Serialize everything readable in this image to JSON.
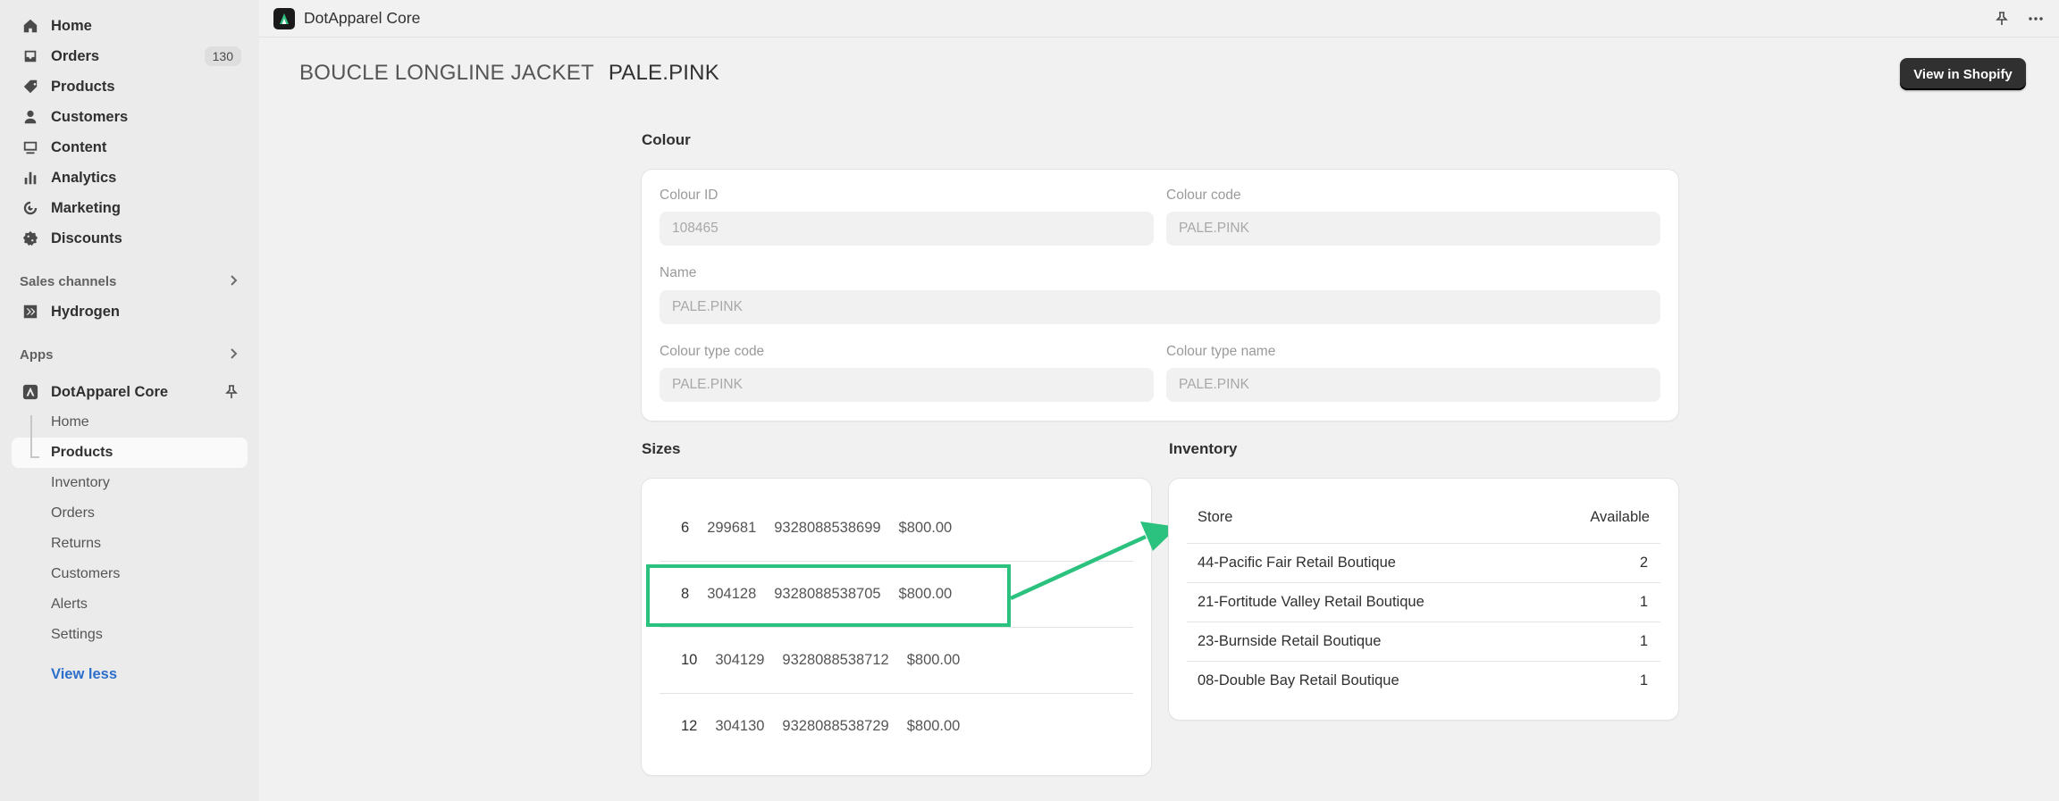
{
  "sidebar": {
    "nav": [
      {
        "label": "Home",
        "icon": "home-icon"
      },
      {
        "label": "Orders",
        "icon": "orders-icon",
        "badge": "130"
      },
      {
        "label": "Products",
        "icon": "tag-icon"
      },
      {
        "label": "Customers",
        "icon": "person-icon"
      },
      {
        "label": "Content",
        "icon": "content-icon"
      },
      {
        "label": "Analytics",
        "icon": "bar-chart-icon"
      },
      {
        "label": "Marketing",
        "icon": "target-icon"
      },
      {
        "label": "Discounts",
        "icon": "discount-icon"
      }
    ],
    "sales_channels_label": "Sales channels",
    "hydrogen_label": "Hydrogen",
    "apps_label": "Apps",
    "app_name": "DotApparel Core",
    "app_items": [
      "Home",
      "Products",
      "Inventory",
      "Orders",
      "Returns",
      "Customers",
      "Alerts",
      "Settings"
    ],
    "active_app_item": "Products",
    "view_less": "View less"
  },
  "topbar": {
    "app_name": "DotApparel Core"
  },
  "header": {
    "product": "BOUCLE LONGLINE JACKET",
    "variant": "PALE.PINK",
    "view_button": "View in Shopify"
  },
  "colour": {
    "title": "Colour",
    "colour_id_label": "Colour ID",
    "colour_id": "108465",
    "colour_code_label": "Colour code",
    "colour_code": "PALE.PINK",
    "name_label": "Name",
    "name": "PALE.PINK",
    "colour_type_code_label": "Colour type code",
    "colour_type_code": "PALE.PINK",
    "colour_type_name_label": "Colour type name",
    "colour_type_name": "PALE.PINK"
  },
  "sizes": {
    "title": "Sizes",
    "rows": [
      {
        "size": "6",
        "id": "299681",
        "barcode": "9328088538699",
        "price": "$800.00"
      },
      {
        "size": "8",
        "id": "304128",
        "barcode": "9328088538705",
        "price": "$800.00"
      },
      {
        "size": "10",
        "id": "304129",
        "barcode": "9328088538712",
        "price": "$800.00"
      },
      {
        "size": "12",
        "id": "304130",
        "barcode": "9328088538729",
        "price": "$800.00"
      }
    ],
    "highlighted_size": "8",
    "highlight_color": "#2bc27f"
  },
  "inventory": {
    "title": "Inventory",
    "store_header": "Store",
    "available_header": "Available",
    "rows": [
      {
        "store": "44-Pacific Fair Retail Boutique",
        "available": "2"
      },
      {
        "store": "21-Fortitude Valley Retail Boutique",
        "available": "1"
      },
      {
        "store": "23-Burnside Retail Boutique",
        "available": "1"
      },
      {
        "store": "08-Double Bay Retail Boutique",
        "available": "1"
      }
    ]
  }
}
